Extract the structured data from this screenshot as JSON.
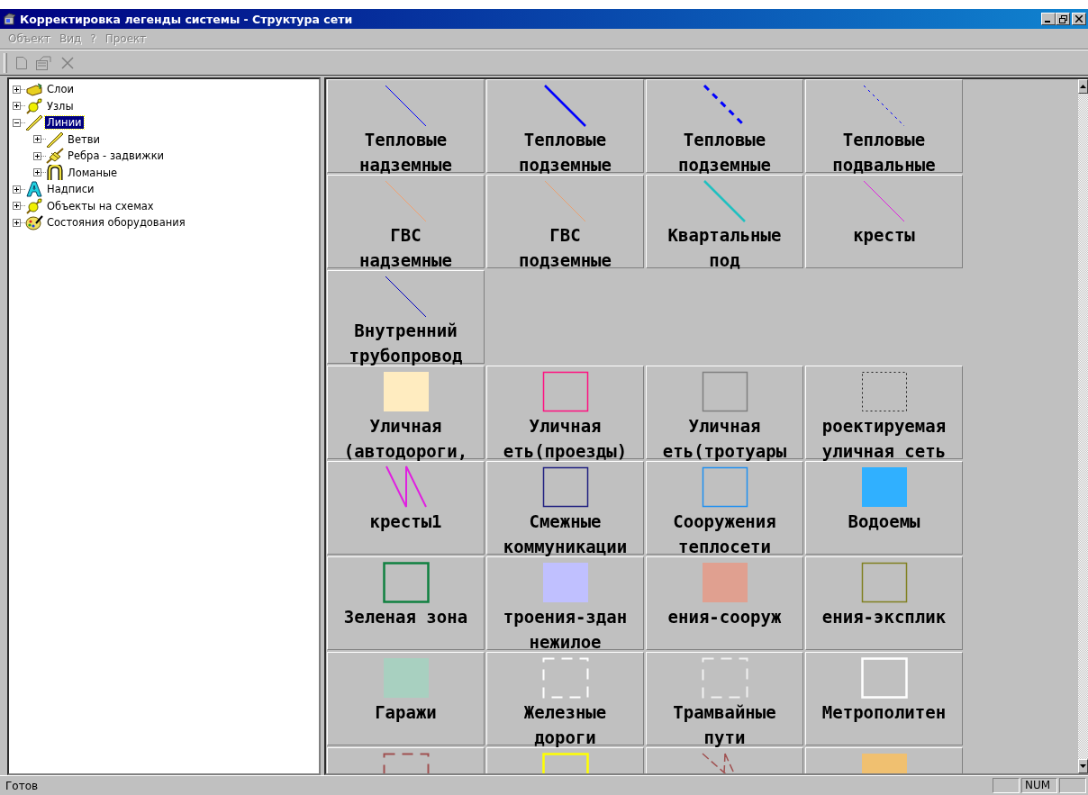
{
  "window": {
    "title": "Корректировка легенды системы - Структура сети"
  },
  "menu": [
    {
      "label": "Объект",
      "disabled": true
    },
    {
      "label": "Вид",
      "disabled": true
    },
    {
      "label": "?",
      "disabled": true
    },
    {
      "label": "Проект",
      "disabled": true
    }
  ],
  "tree": [
    {
      "label": "Слои",
      "expanded": false,
      "selected": false
    },
    {
      "label": "Узлы",
      "expanded": false,
      "selected": false
    },
    {
      "label": "Линии",
      "expanded": true,
      "selected": true,
      "children": [
        {
          "label": "Ветви",
          "expanded": false,
          "selected": false
        },
        {
          "label": "Ребра - задвижки",
          "expanded": false,
          "selected": false
        },
        {
          "label": "Ломаные",
          "expanded": false,
          "selected": false
        }
      ]
    },
    {
      "label": "Надписи",
      "expanded": false,
      "selected": false
    },
    {
      "label": "Объекты на схемах",
      "expanded": false,
      "selected": false
    },
    {
      "label": "Состояния оборудования",
      "expanded": false,
      "selected": false
    }
  ],
  "legend_rows": [
    [
      {
        "label": "Тепловые\nнадземные",
        "kind": "line",
        "color": "#0000ff"
      },
      {
        "label": "Тепловые\nподземные",
        "kind": "thick-line",
        "color": "#0000ff"
      },
      {
        "label": "Тепловые\nподземные",
        "kind": "dash-line",
        "color": "#0000ff"
      },
      {
        "label": "Тепловые\nподвальные",
        "kind": "dot-line",
        "color": "#0000ff"
      }
    ],
    [
      {
        "label": "ГВС\nнадземные",
        "kind": "line",
        "color": "#f0a070"
      },
      {
        "label": "ГВС\nподземные",
        "kind": "line",
        "color": "#e8a070"
      },
      {
        "label": "Квартальные\nпод",
        "kind": "thick-line",
        "color": "#20c0c0"
      },
      {
        "label": "кресты",
        "kind": "line",
        "color": "#e020e0"
      }
    ],
    [
      {
        "label": "Внутренний\nтрубопровод",
        "kind": "line",
        "color": "#0000c0"
      }
    ],
    [
      {
        "label": "Уличная\n(автодороги,",
        "kind": "filled-rect",
        "color": "#ffecc0"
      },
      {
        "label": "Уличная\nеть(проезды)",
        "kind": "rect",
        "color": "#ff1080"
      },
      {
        "label": "Уличная\nеть(тротуары",
        "kind": "rect",
        "color": "#808080"
      },
      {
        "label": "роектируемая\nуличная сеть",
        "kind": "dotted-rect",
        "color": "#202020"
      }
    ],
    [
      {
        "label": "кресты1",
        "kind": "zigzag",
        "color": "#e020e0"
      },
      {
        "label": "Смежные\nкоммуникации",
        "kind": "rect",
        "color": "#202080"
      },
      {
        "label": "Сооружения\nтеплосети",
        "kind": "rect",
        "color": "#2090f0"
      },
      {
        "label": "Водоемы",
        "kind": "filled-rect",
        "color": "#30b0ff"
      }
    ],
    [
      {
        "label": "Зеленая зона",
        "kind": "thick-rect",
        "color": "#108040"
      },
      {
        "label": "троения-здан\nнежилое",
        "kind": "filled-rect",
        "color": "#c0c0ff"
      },
      {
        "label": "ения-сооруж",
        "kind": "filled-rect",
        "color": "#e0a090"
      },
      {
        "label": "ения-эксплик",
        "kind": "rect",
        "color": "#808020"
      }
    ],
    [
      {
        "label": "Гаражи",
        "kind": "filled-rect",
        "color": "#a8d0c0"
      },
      {
        "label": "Железные\nдороги",
        "kind": "dashed-rect",
        "color": "#ffffff"
      },
      {
        "label": "Трамвайные\nпути",
        "kind": "dashed-rect",
        "color": "#f0f0f0"
      },
      {
        "label": "Метрополитен",
        "kind": "thick-rect",
        "color": "#ffffff"
      }
    ],
    [
      {
        "kind": "dashed-rect",
        "color": "#a05050"
      },
      {
        "kind": "thick-rect",
        "color": "#ffff00"
      },
      {
        "kind": "dash-cross",
        "color": "#a05050"
      },
      {
        "kind": "filled-rect",
        "color": "#f0c070"
      }
    ]
  ],
  "status_bar": {
    "text": "Готов",
    "indicator": "NUM"
  }
}
